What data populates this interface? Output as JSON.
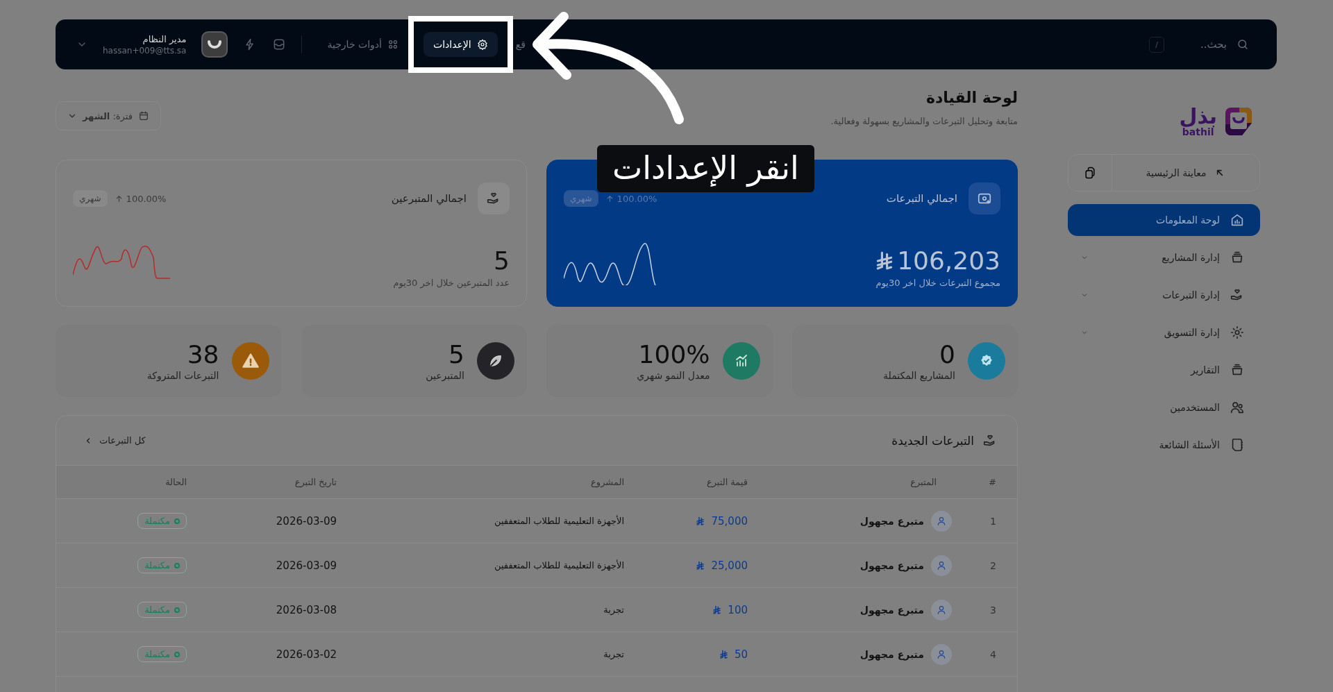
{
  "topbar": {
    "search": {
      "placeholder": "بحث..",
      "shortcut": "/"
    },
    "nav_items": [
      {
        "label": "قع",
        "kind": "plain",
        "highlighted": false
      },
      {
        "label": "الإعدادات",
        "kind": "gear",
        "highlighted": true
      },
      {
        "label": "أدوات خارجية",
        "kind": "grid",
        "highlighted": false
      }
    ],
    "user": {
      "name": "مدير النظام",
      "email": "hassan+009@tts.sa"
    }
  },
  "tutorial": {
    "callout": "انقر الإعدادات"
  },
  "sidebar": {
    "logo": {
      "arabic": "بذل",
      "latin": "bathil"
    },
    "preview_button": "معاينة الرئيسية",
    "items": [
      {
        "label": "لوحة المعلومات",
        "selected": true,
        "expandable": false
      },
      {
        "label": "إدارة المشاريع",
        "selected": false,
        "expandable": true
      },
      {
        "label": "إدارة التبرعات",
        "selected": false,
        "expandable": true
      },
      {
        "label": "إدارة التسويق",
        "selected": false,
        "expandable": true
      },
      {
        "label": "التقارير",
        "selected": false,
        "expandable": false
      },
      {
        "label": "المستخدمين",
        "selected": false,
        "expandable": false
      },
      {
        "label": "الأسئلة الشائعة",
        "selected": false,
        "expandable": false
      }
    ]
  },
  "header": {
    "title": "لوحة القيادة",
    "subtitle": "متابعة وتحليل التبرعات والمشاريع بسهولة وفعالية.",
    "filter": "فترة: **الشهر**"
  },
  "summary_cards": [
    {
      "kind": "primary",
      "title": "اجمالي التبرعات",
      "badge": "شهري",
      "change": "100.00%",
      "value": "106,203",
      "currency": true,
      "caption": "مجموع التبرعات خلال اخر 30يوم"
    },
    {
      "kind": "plain",
      "title": "اجمالي المتبرعين",
      "badge": "شهري",
      "change": "100.00%",
      "value": "5",
      "currency": false,
      "caption": "عدد المتبرعين خلال اخر 30يوم"
    }
  ],
  "stats": [
    {
      "value": "0",
      "label": "المشاريع المكتملة",
      "color": "#1b7b9c"
    },
    {
      "value": "100%",
      "label": "معدل النمو شهري",
      "color": "#1e7a62"
    },
    {
      "value": "5",
      "label": "المتبرعين",
      "color": "#232328"
    },
    {
      "value": "38",
      "label": "التبرعات المتروكة",
      "color": "#9a5a0a"
    }
  ],
  "table": {
    "title": "التبرعات الجديدة",
    "link": "كل التبرعات",
    "columns": [
      "#",
      "المتبرع",
      "قيمة التبرع",
      "المشروع",
      "تاريخ التبرع",
      "الحالة"
    ],
    "rows": [
      {
        "index": "1",
        "donor": "متبرع مجهول",
        "amount": "75,000",
        "project": "الأجهزة التعليمية للطلاب المتعففين",
        "date": "2026-03-09",
        "status": "مكتملة"
      },
      {
        "index": "2",
        "donor": "متبرع مجهول",
        "amount": "25,000",
        "project": "الأجهزة التعليمية للطلاب المتعففين",
        "date": "2026-03-09",
        "status": "مكتملة"
      },
      {
        "index": "3",
        "donor": "متبرع مجهول",
        "amount": "100",
        "project": "تجربة",
        "date": "2026-03-08",
        "status": "مكتملة"
      },
      {
        "index": "4",
        "donor": "متبرع مجهول",
        "amount": "50",
        "project": "تجربة",
        "date": "2026-03-02",
        "status": "مكتملة"
      }
    ]
  }
}
